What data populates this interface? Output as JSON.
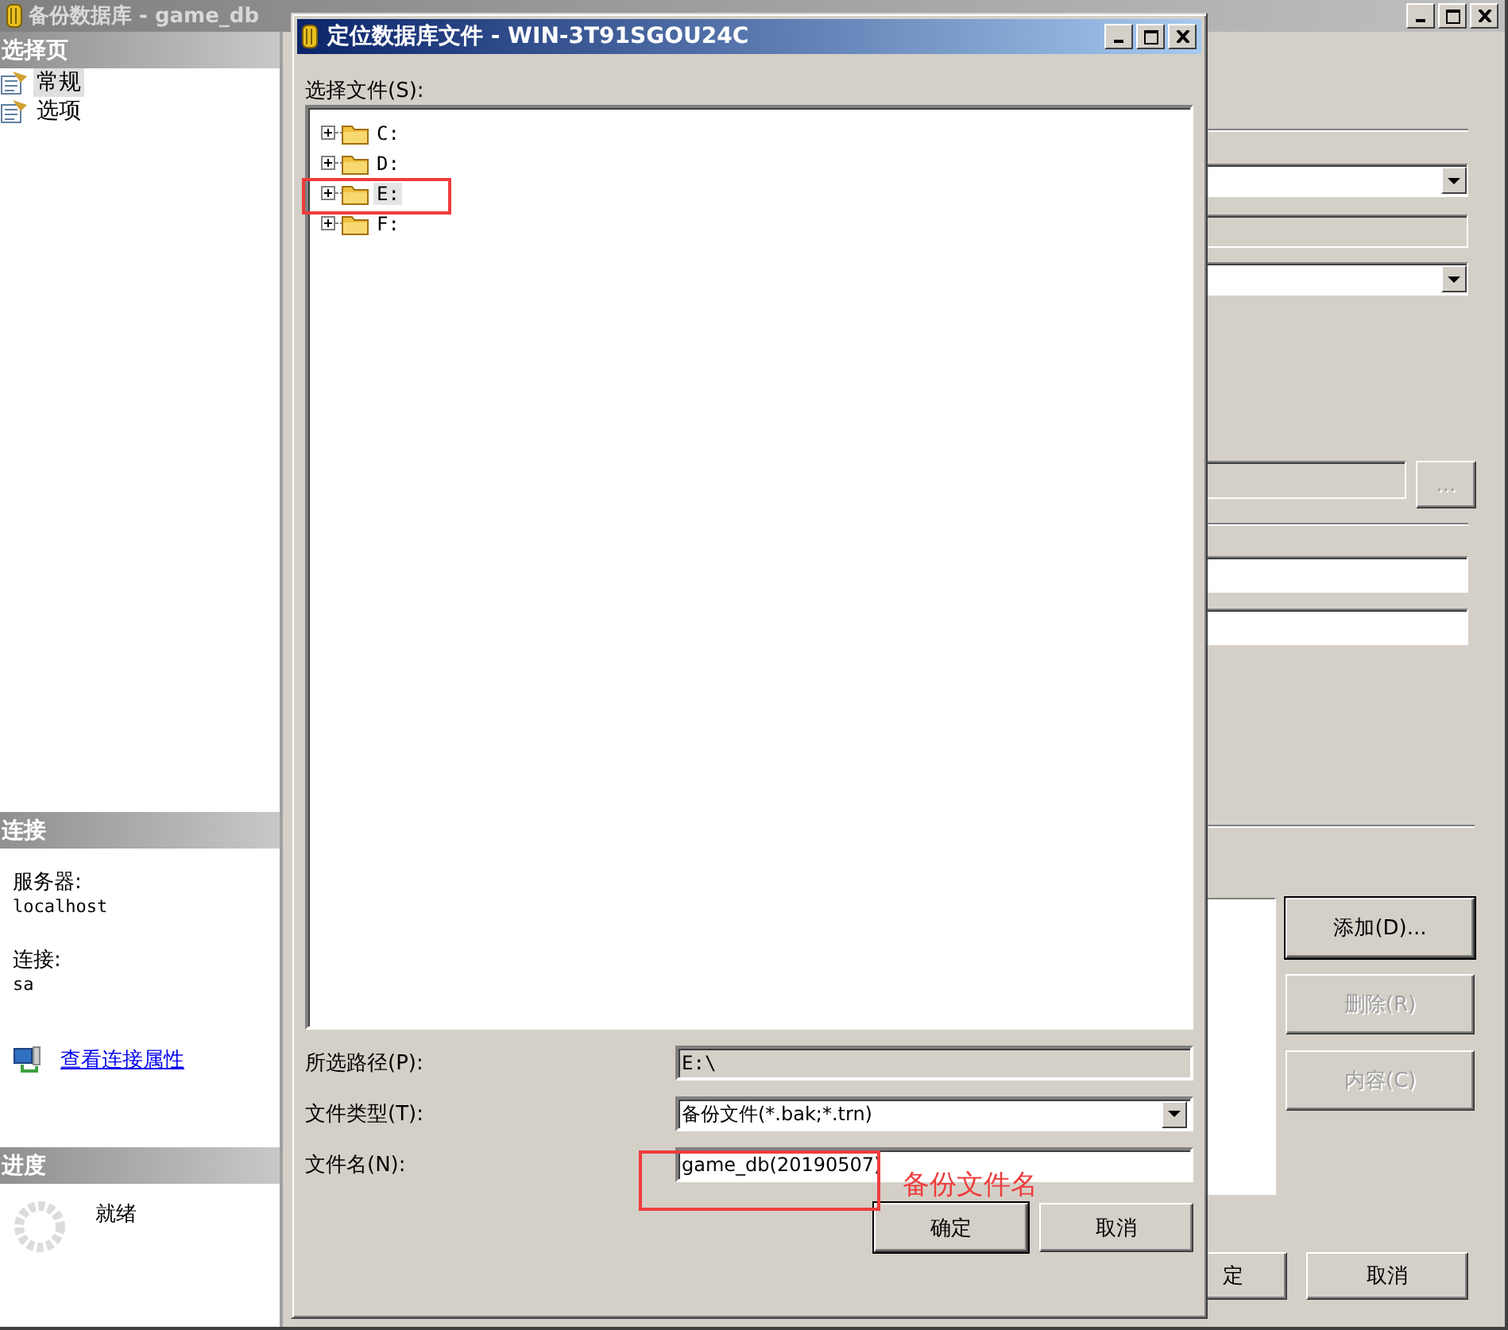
{
  "main_window": {
    "title": "备份数据库 - game_db",
    "pages_header": "选择页",
    "pages": [
      {
        "label": "常规",
        "selected": true
      },
      {
        "label": "选项",
        "selected": false
      }
    ],
    "connection_header": "连接",
    "connection": [
      {
        "label": "服务器:",
        "value": "localhost"
      },
      {
        "label": "连接:",
        "value": "sa"
      }
    ],
    "connection_link": "查看连接属性",
    "progress_header": "进度",
    "progress_status": "就绪",
    "browse_button": "...",
    "destination_buttons": [
      {
        "label": "添加(D)...",
        "disabled": false,
        "default": true
      },
      {
        "label": "删除(R)",
        "disabled": true,
        "default": false
      },
      {
        "label": "内容(C)",
        "disabled": true,
        "default": false
      }
    ],
    "footer_buttons": [
      {
        "label": "定"
      },
      {
        "label": "取消"
      }
    ]
  },
  "dialog": {
    "title": "定位数据库文件 - WIN-3T91SGOU24C",
    "tree_label": "选择文件(S):",
    "drives": [
      {
        "label": "C:",
        "selected": false
      },
      {
        "label": "D:",
        "selected": false
      },
      {
        "label": "E:",
        "selected": true
      },
      {
        "label": "F:",
        "selected": false
      }
    ],
    "fields": [
      {
        "kind": "readonly",
        "label": "所选路径(P):",
        "value": "E:\\"
      },
      {
        "kind": "dropdown",
        "label": "文件类型(T):",
        "value": "备份文件(*.bak;*.trn)"
      },
      {
        "kind": "input",
        "label": "文件名(N):",
        "value": "game_db(20190507)"
      }
    ],
    "buttons": [
      {
        "label": "确定",
        "default": true
      },
      {
        "label": "取消",
        "default": false
      }
    ]
  },
  "annotation": {
    "text": "备份文件名"
  }
}
